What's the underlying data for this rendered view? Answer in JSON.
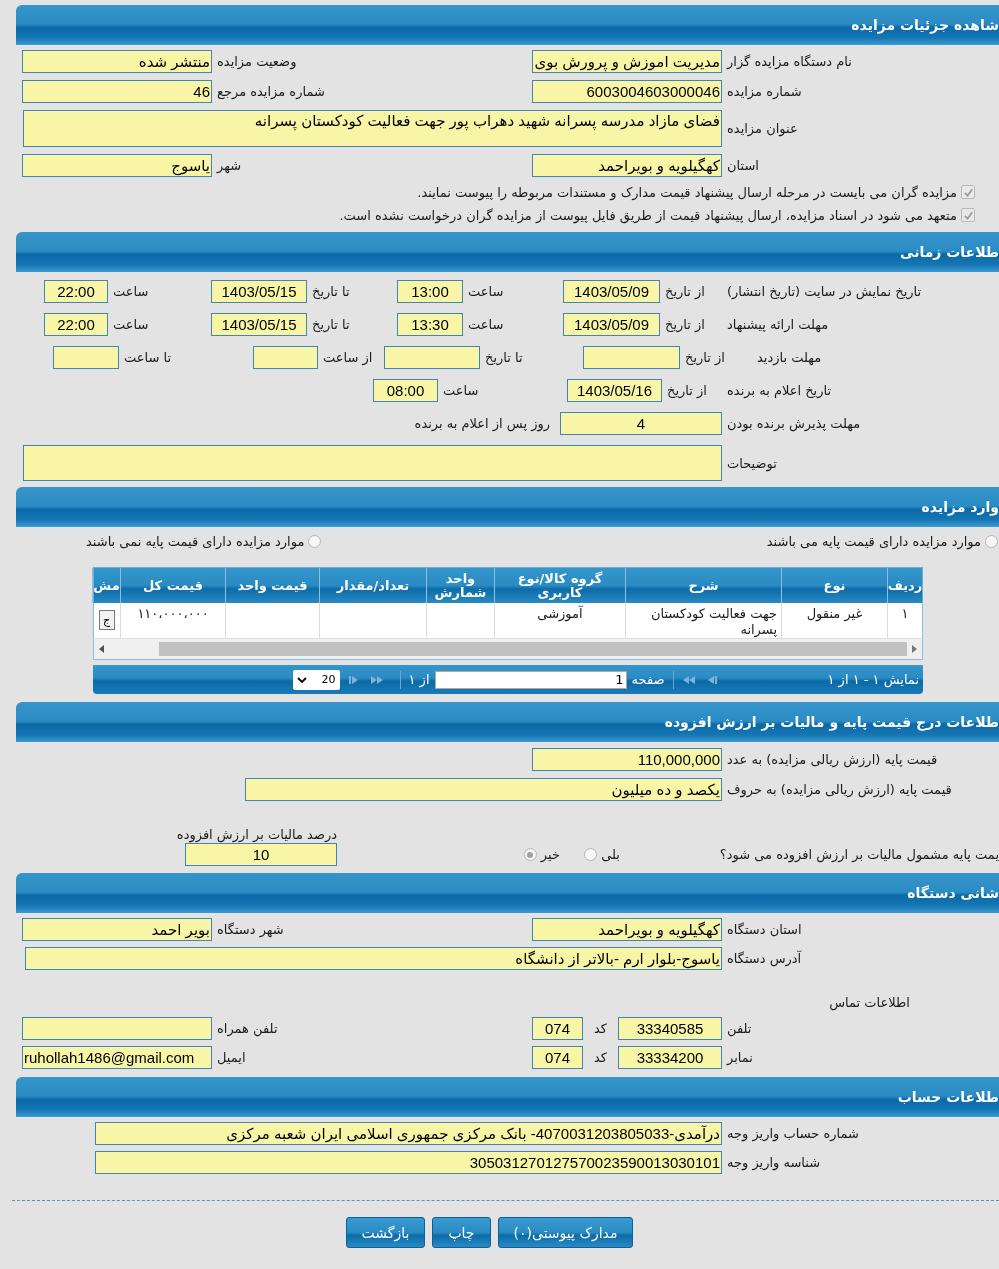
{
  "sections": [
    {
      "title": "شاهده جزئیات مزایده",
      "rows": [
        {
          "kind": "pair",
          "items": [
            {
              "label": "نام دستگاه مزایده گزار",
              "value": "مدیریت اموزش و پرورش بوی"
            },
            {
              "label": "وضعیت مزایده",
              "value": "منتشر شده"
            }
          ]
        },
        {
          "kind": "pair",
          "items": [
            {
              "label": "شماره مزایده",
              "value": "6003004603000046"
            },
            {
              "label": "شماره مزایده مرجع",
              "value": "46"
            }
          ]
        },
        {
          "kind": "area",
          "items": [
            {
              "label": "عنوان مزایده",
              "value": "فضای مازاد مدرسه پسرانه شهید دهراب پور جهت فعالیت کودکستان پسرانه"
            }
          ]
        },
        {
          "kind": "pair",
          "items": [
            {
              "label": "استان",
              "value": "کهگیلویه و بویراحمد"
            },
            {
              "label": "شهر",
              "value": "یاسوج"
            }
          ]
        },
        {
          "kind": "checks",
          "checked": true,
          "text": "مزایده گران می بایست در مرحله ارسال پیشنهاد قیمت مدارک و مستندات مربوطه را پیوست نمایند."
        },
        {
          "kind": "checks",
          "checked": true,
          "text": "متعهد می شود در اسناد مزایده، ارسال پیشنهاد قیمت از طریق فایل پیوست از مزایده گران درخواست نشده است."
        }
      ]
    },
    {
      "title": "طلاعات زمانی",
      "rows": [
        {
          "kind": "dates",
          "label": "تاریخ نمایش در سایت (تاریخ انتشار)",
          "items": [
            {
              "label": "از تاریخ",
              "value": "1403/05/09"
            },
            {
              "label": "ساعت",
              "value": "13:00"
            },
            {
              "label": "تا تاریخ",
              "value": "1403/05/15"
            },
            {
              "label": "ساعت",
              "value": "22:00"
            }
          ]
        },
        {
          "kind": "dates",
          "label": "مهلت ارائه پیشنهاد",
          "items": [
            {
              "label": "از تاریخ",
              "value": "1403/05/09"
            },
            {
              "label": "ساعت",
              "value": "13:30"
            },
            {
              "label": "تا تاریخ",
              "value": "1403/05/15"
            },
            {
              "label": "ساعت",
              "value": "22:00"
            }
          ]
        },
        {
          "kind": "visit",
          "label": "مهلت بازدید",
          "items": [
            {
              "label": "از تاریخ"
            },
            {
              "label": "تا تاریخ"
            },
            {
              "label": "از ساعت"
            },
            {
              "label": "تا ساعت"
            }
          ]
        },
        {
          "kind": "win",
          "label": "تاریخ اعلام به برنده",
          "items": [
            {
              "label": "از تاریخ",
              "value": "1403/05/16"
            },
            {
              "label": "ساعت",
              "value": "08:00"
            }
          ]
        },
        {
          "kind": "days",
          "label": "مهلت پذیرش برنده بودن",
          "items": [
            {
              "value": "4",
              "suffix": "روز پس از اعلام به برنده"
            }
          ]
        },
        {
          "kind": "area",
          "items": [
            {
              "label": "توضیحات"
            }
          ]
        }
      ]
    },
    {
      "title": "وارد مزایده",
      "rows": [
        {
          "kind": "radios",
          "options": [
            {
              "selected": false,
              "text": "موارد مزایده دارای قیمت پایه می باشند"
            },
            {
              "selected": false,
              "text": "موارد مزایده دارای قیمت پایه نمی باشند"
            }
          ]
        },
        {
          "kind": "table",
          "columns": [
            "ردیف",
            "نوع",
            "شرح",
            "گروه کالا/نوع کاربری",
            "واحد شمارش",
            "تعداد/مقدار",
            "قیمت واحد",
            "قیمت کل",
            "مش"
          ],
          "rows": [
            {
              "row_number": "۱",
              "type": "غیر منقول",
              "description": "جهت فعالیت کودکستان پسرانه",
              "category": "آموزشی",
              "total_price": "۱۱۰،۰۰۰،۰۰۰",
              "action": "ج"
            }
          ],
          "pager": {
            "summary": "نمایش ۱ - ۱ از ۱",
            "page_label": "صفحه",
            "page": "1",
            "page_count": "از ۱",
            "page_size": "20"
          }
        }
      ]
    },
    {
      "title": "طلاعات درج قیمت پایه و مالیات بر ارزش افزوده",
      "rows": [
        {
          "kind": "one",
          "items": [
            {
              "label": "قیمت پایه (ارزش ریالی مزایده) به عدد",
              "value": "110,000,000"
            }
          ]
        },
        {
          "kind": "wide",
          "items": [
            {
              "label": "قیمت پایه (ارزش ریالی مزایده) به حروف",
              "value": "یکصد و ده میلیون"
            }
          ]
        },
        {
          "kind": "vat",
          "question": "یمت پایه مشمول مالیات بر ارزش افزوده می شود؟",
          "options": [
            {
              "selected": false,
              "text": "بلی"
            },
            {
              "selected": true,
              "text": "خیر"
            }
          ],
          "tax": {
            "label": "درصد مالیات بر ارزش افزوده",
            "value": "10"
          }
        }
      ]
    },
    {
      "title": "شانی دستگاه",
      "rows": [
        {
          "kind": "pair",
          "items": [
            {
              "label": "استان دستگاه",
              "value": "کهگیلویه و بویراحمد"
            },
            {
              "label": "شهر دستگاه",
              "value": "بویر احمد"
            }
          ]
        },
        {
          "kind": "addr",
          "items": [
            {
              "label": "آدرس دستگاه",
              "value": "یاسوج-بلوار ارم -بالاتر از دانشگاه"
            }
          ]
        },
        {
          "kind": "caption",
          "text": "اطلاعات تماس"
        },
        {
          "kind": "contact",
          "items": [
            {
              "label": "تلفن",
              "value": "33340585"
            },
            {
              "label": "کد",
              "value": "074"
            },
            {
              "label": "تلفن همراه"
            }
          ]
        },
        {
          "kind": "contact",
          "items": [
            {
              "label": "نمابر",
              "value": "33334200"
            },
            {
              "label": "کد",
              "value": "074"
            },
            {
              "label": "ایمیل",
              "value": "ruhollah1486@gmail.com"
            }
          ]
        }
      ]
    },
    {
      "title": "طلاعات حساب",
      "rows": [
        {
          "kind": "acct",
          "items": [
            {
              "label": "شماره حساب واریز وجه",
              "value": "درآمدی-4070031203805033- بانک مرکزی جمهوری اسلامی ایران شعبه مرکزی"
            }
          ]
        },
        {
          "kind": "acct",
          "items": [
            {
              "label": "شناسه واریز وجه",
              "value": "305031270127570023590013030101"
            }
          ]
        }
      ]
    }
  ],
  "buttons": [
    "مدارک پیوستی(۰)",
    "چاپ",
    "بازگشت"
  ]
}
